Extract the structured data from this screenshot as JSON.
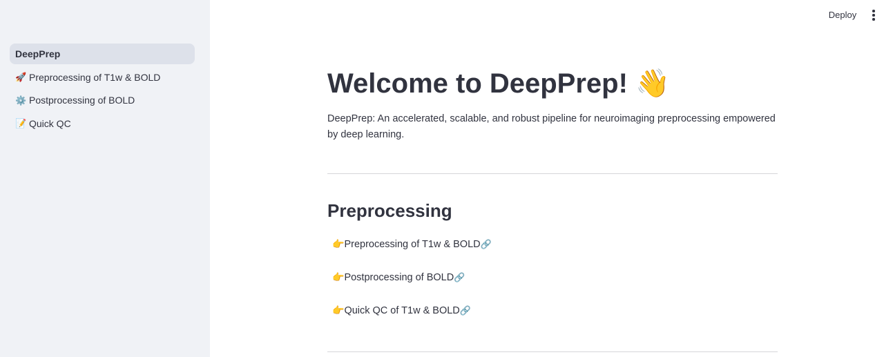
{
  "header": {
    "deploy_label": "Deploy",
    "menu_icon": "kebab-menu-icon"
  },
  "sidebar": {
    "items": [
      {
        "label": "DeepPrep",
        "icon": "",
        "active": true
      },
      {
        "label": "Preprocessing of T1w & BOLD",
        "icon": "🚀",
        "active": false
      },
      {
        "label": "Postprocessing of BOLD",
        "icon": "⚙️",
        "active": false
      },
      {
        "label": "Quick QC",
        "icon": "📝",
        "active": false
      }
    ]
  },
  "main": {
    "title": "Welcome to DeepPrep! 👋",
    "intro": "DeepPrep: An accelerated, scalable, and robust pipeline for neuroimaging preprocessing empowered by deep learning.",
    "section_heading": "Preprocessing",
    "links": [
      {
        "prefix": "👉",
        "label": "Preprocessing of T1w & BOLD",
        "suffix": "🔗"
      },
      {
        "prefix": "👉",
        "label": "Postprocessing of BOLD",
        "suffix": "🔗"
      },
      {
        "prefix": "👉",
        "label": "Quick QC of T1w & BOLD",
        "suffix": "🔗"
      }
    ]
  },
  "colors": {
    "sidebar_bg": "#f0f2f6",
    "active_item_bg": "#dde1ea",
    "text": "#31333f",
    "divider": "#d6d6d9"
  }
}
